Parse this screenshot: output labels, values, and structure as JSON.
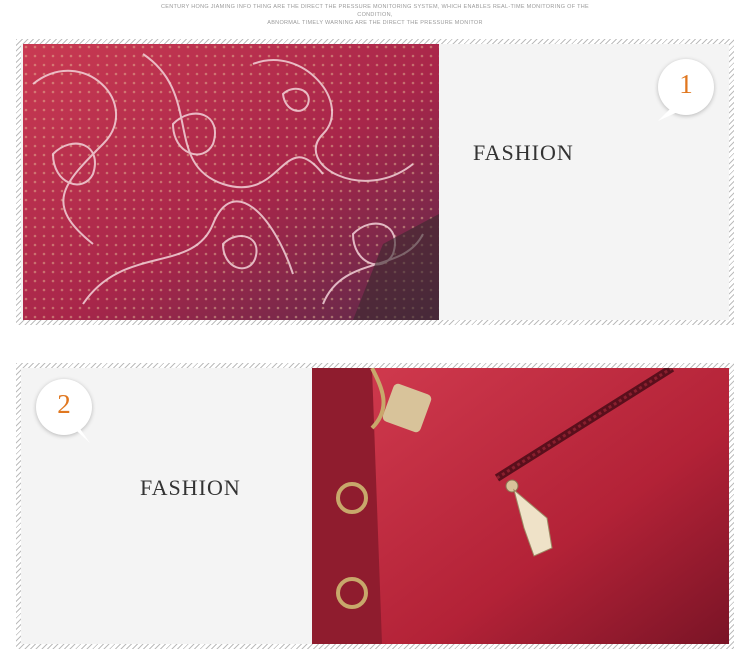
{
  "header": {
    "caption_line_1": "Century Hong Jiaming info thing are the direct the pressure monitoring system, which enables real-time monitoring of the condition,",
    "caption_line_2": "abnormal timely warning are the direct the pressure monitor"
  },
  "panels": [
    {
      "number": "1",
      "label": "FASHION",
      "photo": "embossed-leather-pattern-image"
    },
    {
      "number": "2",
      "label": "FASHION",
      "photo": "red-leather-bag-zipper-image"
    }
  ],
  "colors": {
    "accent_number": "#e0771f",
    "panel_bg": "#f4f4f4",
    "hatch": "#bdbdbd",
    "leather_red": "#b8233b"
  }
}
